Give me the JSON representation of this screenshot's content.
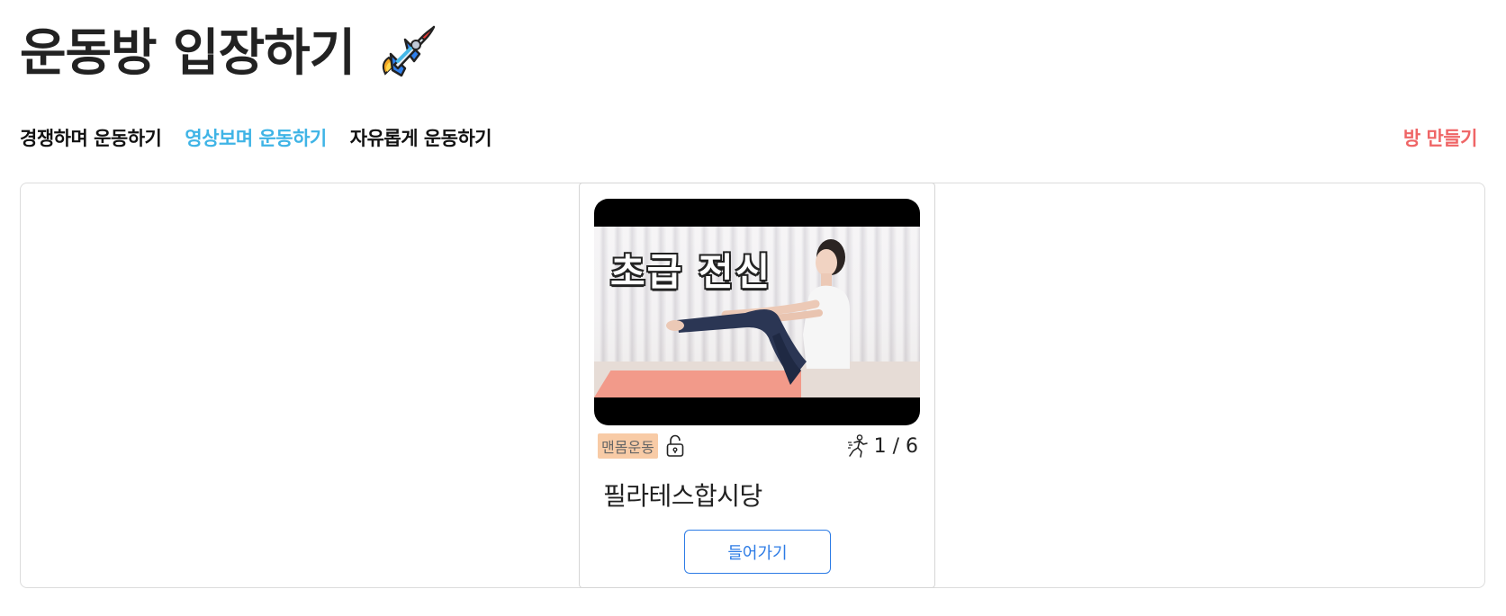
{
  "page": {
    "title": "운동방 입장하기",
    "title_icon": "rocket-icon"
  },
  "nav": {
    "tabs": [
      {
        "label": "경쟁하며 운동하기",
        "active": false
      },
      {
        "label": "영상보며 운동하기",
        "active": true
      },
      {
        "label": "자유롭게 운동하기",
        "active": false
      }
    ],
    "create_room": "방 만들기"
  },
  "colors": {
    "active_tab": "#3fb4e6",
    "create_room": "#ef6566",
    "badge_bg": "#f8cba6",
    "button_accent": "#2c7be5"
  },
  "room": {
    "thumbnail_caption": "초급 전신",
    "category": "맨몸운동",
    "lock_icon": "unlock-icon",
    "participants_icon": "runner-icon",
    "participants": "1 / 6",
    "name": "필라테스합시당",
    "enter_label": "들어가기"
  }
}
